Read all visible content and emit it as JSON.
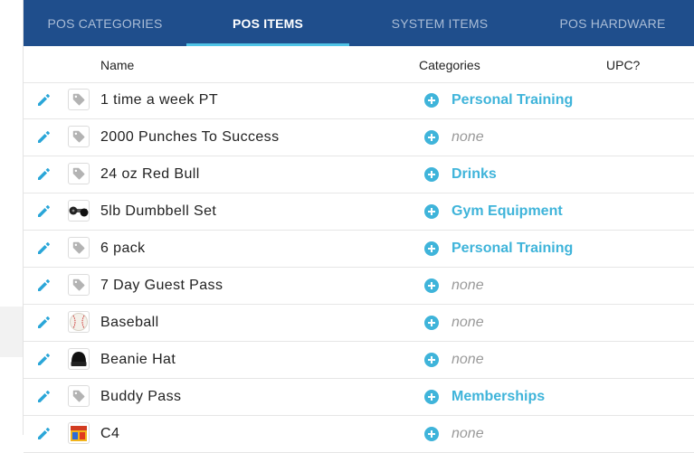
{
  "tabs": [
    {
      "label": "POS CATEGORIES",
      "active": false
    },
    {
      "label": "POS ITEMS",
      "active": true
    },
    {
      "label": "SYSTEM ITEMS",
      "active": false
    },
    {
      "label": "POS HARDWARE",
      "active": false
    }
  ],
  "columns": {
    "name": "Name",
    "categories": "Categories",
    "upc": "UPC?"
  },
  "rows": [
    {
      "name": "1 time a week PT",
      "category": "Personal Training",
      "has_category": true,
      "thumb": "tag-icon"
    },
    {
      "name": "2000 Punches To Success",
      "category": "none",
      "has_category": false,
      "thumb": "tag-icon"
    },
    {
      "name": "24 oz Red Bull",
      "category": "Drinks",
      "has_category": true,
      "thumb": "tag-icon"
    },
    {
      "name": "5lb Dumbbell Set",
      "category": "Gym Equipment",
      "has_category": true,
      "thumb": "dumbbell-image"
    },
    {
      "name": "6 pack",
      "category": "Personal Training",
      "has_category": true,
      "thumb": "tag-icon"
    },
    {
      "name": "7 Day Guest Pass",
      "category": "none",
      "has_category": false,
      "thumb": "tag-icon"
    },
    {
      "name": "Baseball",
      "category": "none",
      "has_category": false,
      "thumb": "baseball-image"
    },
    {
      "name": "Beanie Hat",
      "category": "none",
      "has_category": false,
      "thumb": "beanie-image"
    },
    {
      "name": "Buddy Pass",
      "category": "Memberships",
      "has_category": true,
      "thumb": "tag-icon"
    },
    {
      "name": "C4",
      "category": "none",
      "has_category": false,
      "thumb": "c4-image"
    }
  ],
  "colors": {
    "tabbar": "#1f4e8c",
    "tab_indicator": "#4fc3e6",
    "category_link": "#3fb4da",
    "none_text": "#9a9a9a"
  }
}
